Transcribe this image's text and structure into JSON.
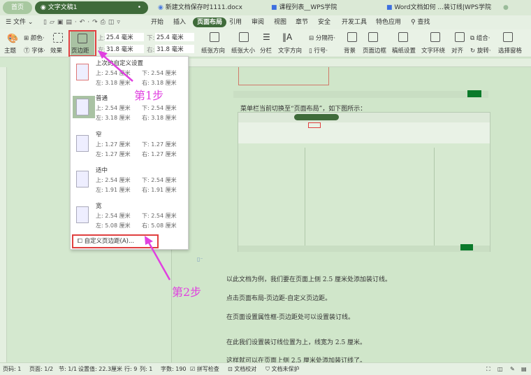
{
  "tabs": [
    {
      "label": "首页"
    },
    {
      "label": "文字文稿1"
    },
    {
      "label": "新建文档保存时1111.docx"
    },
    {
      "label": "课程列表__WPS学院"
    },
    {
      "label": "Word文档如何 ...装订线|WPS学院"
    }
  ],
  "menu": {
    "file": "文件",
    "items": [
      "开始",
      "插入",
      "页面布局",
      "引用",
      "审阅",
      "视图",
      "章节",
      "安全",
      "开发工具",
      "特色应用"
    ],
    "search": "查找"
  },
  "ribbon": {
    "theme": "主题",
    "color": "颜色",
    "font": "字体",
    "effect": "效果",
    "margin": "页边距",
    "top_label": "上:",
    "top": "25.4 毫米",
    "bottom_label": "下:",
    "bottom": "25.4 毫米",
    "left_label": "左:",
    "left": "31.8 毫米",
    "right_label": "右:",
    "right": "31.8 毫米",
    "orientation": "纸张方向",
    "size": "纸张大小",
    "columns": "分栏",
    "text_dir": "文字方向",
    "breaks": "分隔符",
    "line_num": "行号",
    "background": "背景",
    "border": "页面边框",
    "grid": "稿纸设置",
    "wrap": "文字环绕",
    "align": "对齐",
    "group": "组合",
    "rotate": "旋转",
    "pane": "选择窗格"
  },
  "dropdown": {
    "options": [
      {
        "name": "上次的自定义设置",
        "top": "上: 2.54 厘米",
        "bottom": "下: 2.54 厘米",
        "left": "左: 3.18 厘米",
        "right": "右: 3.18 厘米"
      },
      {
        "name": "普通",
        "top": "上: 2.54 厘米",
        "bottom": "下: 2.54 厘米",
        "left": "左: 3.18 厘米",
        "right": "右: 3.18 厘米"
      },
      {
        "name": "窄",
        "top": "上: 1.27 厘米",
        "bottom": "下: 1.27 厘米",
        "left": "左: 1.27 厘米",
        "right": "右: 1.27 厘米"
      },
      {
        "name": "适中",
        "top": "上: 2.54 厘米",
        "bottom": "下: 2.54 厘米",
        "left": "左: 1.91 厘米",
        "right": "右: 1.91 厘米"
      },
      {
        "name": "宽",
        "top": "上: 2.54 厘米",
        "bottom": "下: 2.54 厘米",
        "left": "左: 5.08 厘米",
        "right": "右: 5.08 厘米"
      }
    ],
    "custom": "自定义页边距(A)..."
  },
  "annotations": {
    "step1": "第1步",
    "step2": "第2步"
  },
  "document": {
    "caption": "菜单栏当前切换至“页面布局”，如下图所示：",
    "paragraphs": [
      "以此文档为例，我们要在页面上侧 2.5 厘米处添加装订线。",
      "点击页面布局-页边距-自定义页边距。",
      "在页面设置属性框-页边距处可以设置装订线。",
      "在此我们设置装订线位置为上，线宽为 2.5 厘米。",
      "这样就可以在页面上侧 2.5 厘米处添加装订线了。"
    ]
  },
  "status": {
    "page": "页码: 1",
    "pages": "页面: 1/2",
    "section": "节: 1/1",
    "setting": "设置值: 22.3厘米",
    "row": "行: 9",
    "col": "列: 1",
    "words": "字数: 190",
    "spell": "拼写检查",
    "proof": "文档校对",
    "protect": "文档未保护"
  }
}
